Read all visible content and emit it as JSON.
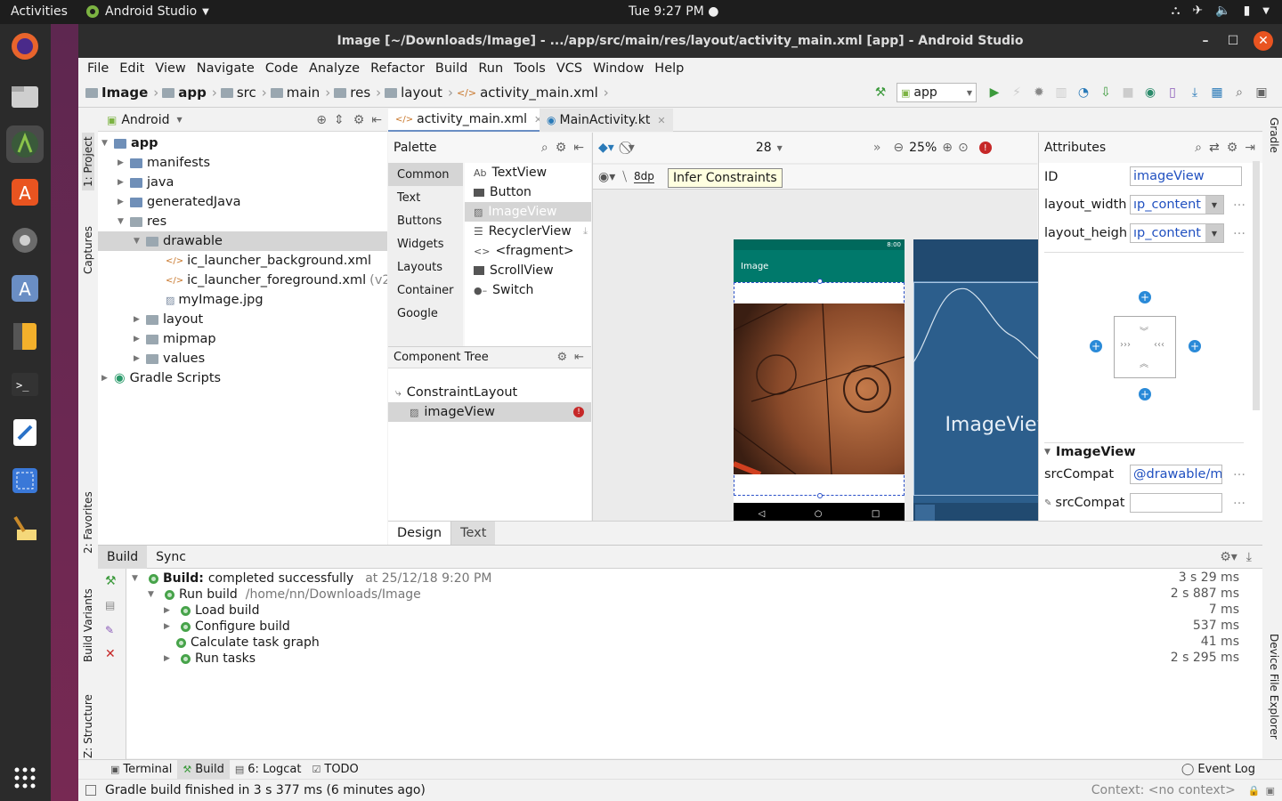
{
  "gnome": {
    "activities": "Activities",
    "app_name": "Android Studio",
    "clock": "Tue  9:27 PM ●"
  },
  "window": {
    "title": "Image [~/Downloads/Image] - .../app/src/main/res/layout/activity_main.xml [app] - Android Studio"
  },
  "menu": [
    "File",
    "Edit",
    "View",
    "Navigate",
    "Code",
    "Analyze",
    "Refactor",
    "Build",
    "Run",
    "Tools",
    "VCS",
    "Window",
    "Help"
  ],
  "breadcrumb": [
    "Image",
    "app",
    "src",
    "main",
    "res",
    "layout",
    "activity_main.xml"
  ],
  "run_config": "app",
  "side_tools": {
    "project": "1: Project",
    "captures": "Captures",
    "favorites": "2: Favorites",
    "build_variants": "Build Variants",
    "structure": "Z: Structure",
    "gradle": "Gradle",
    "device_explorer": "Device File Explorer"
  },
  "project": {
    "view_mode": "Android",
    "tree": [
      {
        "label": "app",
        "bold": true
      },
      {
        "label": "manifests"
      },
      {
        "label": "java"
      },
      {
        "label": "generatedJava"
      },
      {
        "label": "res"
      },
      {
        "label": "drawable"
      },
      {
        "label": "ic_launcher_background.xml"
      },
      {
        "label": "ic_launcher_foreground.xml",
        "suffix": "(v24)"
      },
      {
        "label": "myImage.jpg"
      },
      {
        "label": "layout"
      },
      {
        "label": "mipmap"
      },
      {
        "label": "values"
      },
      {
        "label": "Gradle Scripts"
      }
    ]
  },
  "editor_tabs": [
    {
      "label": "activity_main.xml"
    },
    {
      "label": "MainActivity.kt"
    }
  ],
  "palette": {
    "title": "Palette",
    "categories": [
      "Common",
      "Text",
      "Buttons",
      "Widgets",
      "Layouts",
      "Container",
      "Google"
    ],
    "items": [
      {
        "icon": "Ab",
        "label": "TextView"
      },
      {
        "icon": "btn",
        "label": "Button"
      },
      {
        "icon": "img",
        "label": "ImageView"
      },
      {
        "icon": "list",
        "label": "RecyclerView"
      },
      {
        "icon": "<>",
        "label": "<fragment>"
      },
      {
        "icon": "scroll",
        "label": "ScrollView"
      },
      {
        "icon": "switch",
        "label": "Switch"
      }
    ]
  },
  "component_tree": {
    "title": "Component Tree",
    "items": [
      "ConstraintLayout",
      "imageView"
    ]
  },
  "design_toolbar": {
    "api": "28",
    "zoom": "25%",
    "margin": "8dp",
    "tooltip": "Infer Constraints"
  },
  "phone_preview": {
    "time": "8:00",
    "app_title": "Image",
    "blueprint_label": "ImageView"
  },
  "design_tabs": [
    "Design",
    "Text"
  ],
  "attributes": {
    "title": "Attributes",
    "id_label": "ID",
    "id_value": "imageView",
    "width_label": "layout_width",
    "width_value": "ıp_content",
    "height_label": "layout_heigh",
    "height_value": "ıp_content",
    "section": "ImageView",
    "src_label": "srcCompat",
    "src_value": "@drawable/m",
    "src2_label": "srcCompat",
    "src2_value": ""
  },
  "build": {
    "tabs": [
      "Build",
      "Sync"
    ],
    "rows": [
      {
        "bold": "Build:",
        "text": " completed successfully",
        "extra": "at 25/12/18 9:20 PM",
        "time": "3 s 29 ms"
      },
      {
        "text": "Run build",
        "extra": "/home/nn/Downloads/Image",
        "time": "2 s 887 ms"
      },
      {
        "text": "Load build",
        "time": "7 ms"
      },
      {
        "text": "Configure build",
        "time": "537 ms"
      },
      {
        "text": "Calculate task graph",
        "time": "41 ms"
      },
      {
        "text": "Run tasks",
        "time": "2 s 295 ms"
      }
    ]
  },
  "bottom_tabs": [
    "Terminal",
    "Build",
    "6: Logcat",
    "TODO"
  ],
  "event_log": "Event Log",
  "status": {
    "message": "Gradle build finished in 3 s 377 ms (6 minutes ago)",
    "context": "Context: <no context>"
  },
  "colors": {
    "accent_teal": "#00796b",
    "blueprint": "#2c5e8c",
    "selection": "#d5d5d5",
    "error": "#c62828",
    "run_green": "#3c9a3c"
  }
}
